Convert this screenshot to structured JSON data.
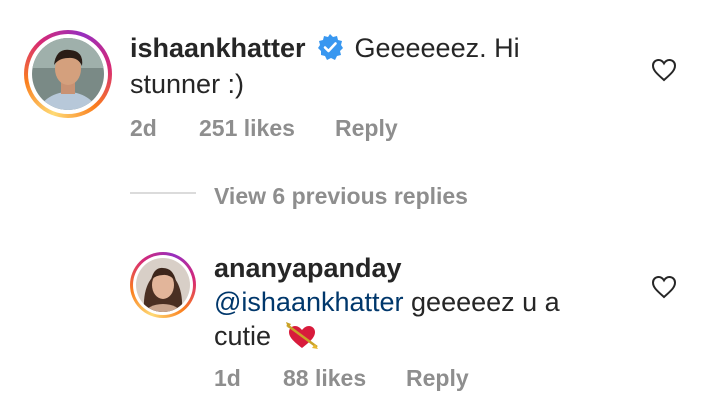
{
  "comments": [
    {
      "username": "ishaankhatter",
      "verified": true,
      "text_line1": "Geeeeeez. Hi",
      "text_line2": "stunner :)",
      "time": "2d",
      "likes": "251 likes",
      "reply": "Reply"
    }
  ],
  "view_replies": "View 6 previous replies",
  "reply": {
    "username": "ananyapanday",
    "mention": "@ishaankhatter",
    "text_rest": "geeeeez u a",
    "text_line2": "cutie",
    "emoji": "heart-with-arrow-emoji",
    "time": "1d",
    "likes": "88 likes",
    "reply": "Reply"
  },
  "colors": {
    "text": "#262626",
    "meta": "#8e8e8e",
    "mention": "#00376b",
    "verified": "#3897f0"
  }
}
